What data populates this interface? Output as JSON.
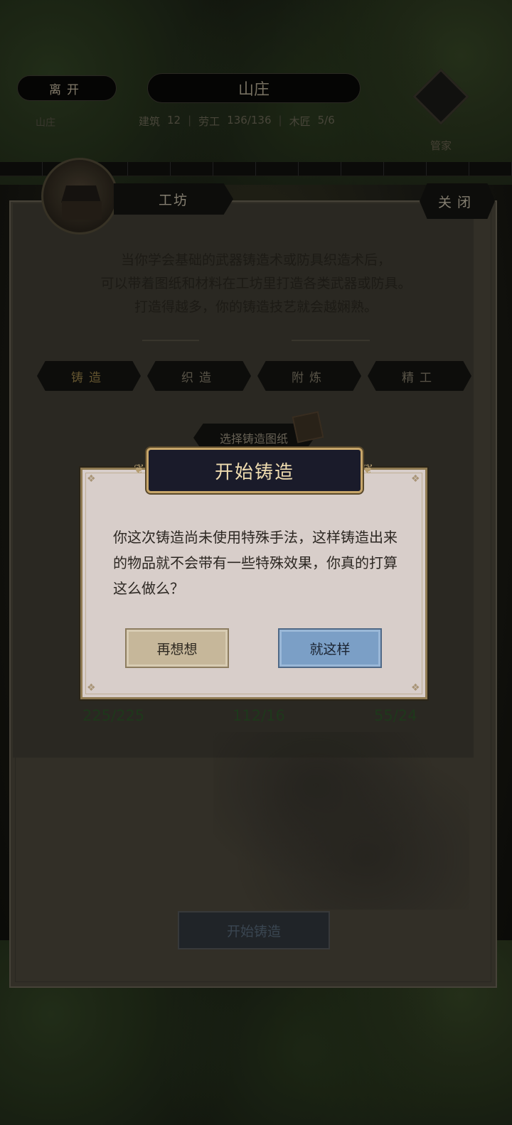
{
  "topbar": {
    "leave_label": "离开",
    "location_title": "山庄",
    "stats": {
      "building_label": "建筑",
      "building_value": "12",
      "labor_label": "劳工",
      "labor_value": "136/136",
      "carpenter_label": "木匠",
      "carpenter_value": "5/6"
    },
    "left_info_line1": "山庄",
    "steward_label": "管家"
  },
  "workshop": {
    "title": "工坊",
    "close_label": "关闭",
    "intro_lines": [
      "当你学会基础的武器铸造术或防具织造术后，",
      "可以带着图纸和材料在工坊里打造各类武器或防具。",
      "打造得越多，你的铸造技艺就会越娴熟。"
    ],
    "tabs": [
      {
        "label": "铸造",
        "active": true
      },
      {
        "label": "织造",
        "active": false
      },
      {
        "label": "附炼",
        "active": false
      },
      {
        "label": "精工",
        "active": false
      }
    ],
    "select_blueprint_label": "选择铸造图纸",
    "materials": [
      "225/225",
      "112/16",
      "55/24"
    ],
    "start_button_label": "开始铸造"
  },
  "dialog": {
    "title": "开始铸造",
    "message": "你这次铸造尚未使用特殊手法，这样铸造出来的物品就不会带有一些特殊效果，你真的打算这么做么？",
    "cancel_label": "再想想",
    "confirm_label": "就这样"
  },
  "colors": {
    "dialog_bg": "#d8ceca",
    "header_bg": "#1a1b2a",
    "header_border": "#c7a66a",
    "confirm_bg": "#7b9fc6",
    "cancel_bg": "#c6b79a"
  }
}
